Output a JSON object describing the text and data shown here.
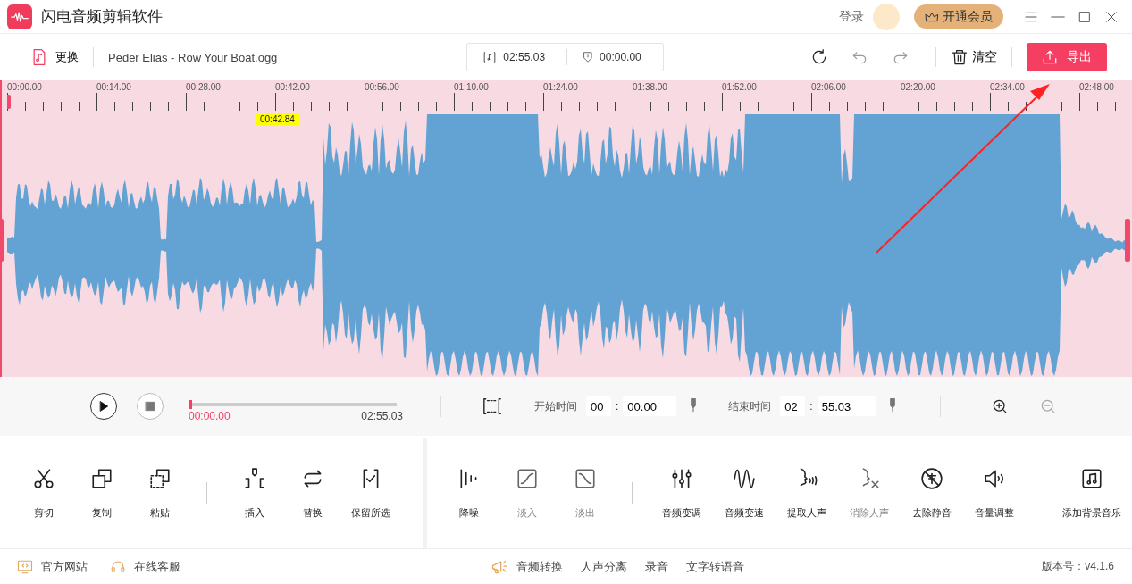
{
  "app": {
    "title": "闪电音频剪辑软件"
  },
  "title_bar": {
    "login": "登录",
    "vip_button": "开通会员"
  },
  "toolbar": {
    "replace": "更换",
    "file_name": "Peder Elias - Row Your Boat.ogg",
    "duration": "02:55.03",
    "position": "00:00.00",
    "clear": "清空",
    "export": "导出"
  },
  "timeline": {
    "ticks": [
      "00:00.00",
      "00:14.00",
      "00:28.00",
      "00:42.00",
      "00:56.00",
      "01:10.00",
      "01:24.00",
      "01:38.00",
      "01:52.00",
      "02:06.00",
      "02:20.00",
      "02:34.00",
      "02:48.00"
    ],
    "marker": "00:42.84"
  },
  "playback": {
    "level": 0,
    "current": "00:00.00",
    "total": "02:55.03",
    "stop_disabled": true,
    "start_label": "开始时间",
    "start_min": "00",
    "start_sep": ":",
    "start_sec": "00.00",
    "end_label": "结束时间",
    "end_min": "02",
    "end_sep": ":",
    "end_sec": "55.03",
    "zoom_out_disabled": true
  },
  "tool_panels": [
    {
      "groups": [
        {
          "tools": [
            {
              "kind": "scissors",
              "label": "剪切",
              "disabled": false
            },
            {
              "kind": "copy",
              "label": "复制",
              "disabled": false
            },
            {
              "kind": "paste",
              "label": "粘贴",
              "disabled": false
            }
          ]
        },
        {
          "tools": [
            {
              "kind": "insert",
              "label": "插入",
              "disabled": false
            },
            {
              "kind": "swap",
              "label": "替换",
              "disabled": false
            },
            {
              "kind": "keep",
              "label": "保留所选",
              "disabled": false
            }
          ]
        }
      ]
    },
    {
      "groups": [
        {
          "tools": [
            {
              "kind": "denoise",
              "label": "降噪",
              "disabled": false
            },
            {
              "kind": "fadein",
              "label": "淡入",
              "disabled": true
            },
            {
              "kind": "fadeout",
              "label": "淡出",
              "disabled": true
            }
          ]
        },
        {
          "tools": [
            {
              "kind": "sliders",
              "label": "音频变调",
              "disabled": false
            },
            {
              "kind": "wave",
              "label": "音频变速",
              "disabled": false
            },
            {
              "kind": "voice",
              "label": "提取人声",
              "disabled": false
            },
            {
              "kind": "voicex",
              "label": "消除人声",
              "disabled": true
            },
            {
              "kind": "nosilence",
              "label": "去除静音",
              "disabled": false
            },
            {
              "kind": "speaker",
              "label": "音量调整",
              "disabled": false
            }
          ]
        },
        {
          "tools": [
            {
              "kind": "note",
              "label": "添加背景音乐",
              "disabled": false
            }
          ]
        }
      ]
    }
  ],
  "footer": {
    "links": [
      {
        "kind": "monitor",
        "label": "官方网站"
      },
      {
        "kind": "headset",
        "label": "在线客服"
      }
    ],
    "center": [
      {
        "kind": "megaphone",
        "label": "音频转换"
      },
      {
        "kind": "text",
        "label": "人声分离"
      },
      {
        "kind": "text",
        "label": "录音"
      },
      {
        "kind": "text",
        "label": "文字转语音"
      }
    ],
    "version": "版本号：v4.1.6"
  }
}
